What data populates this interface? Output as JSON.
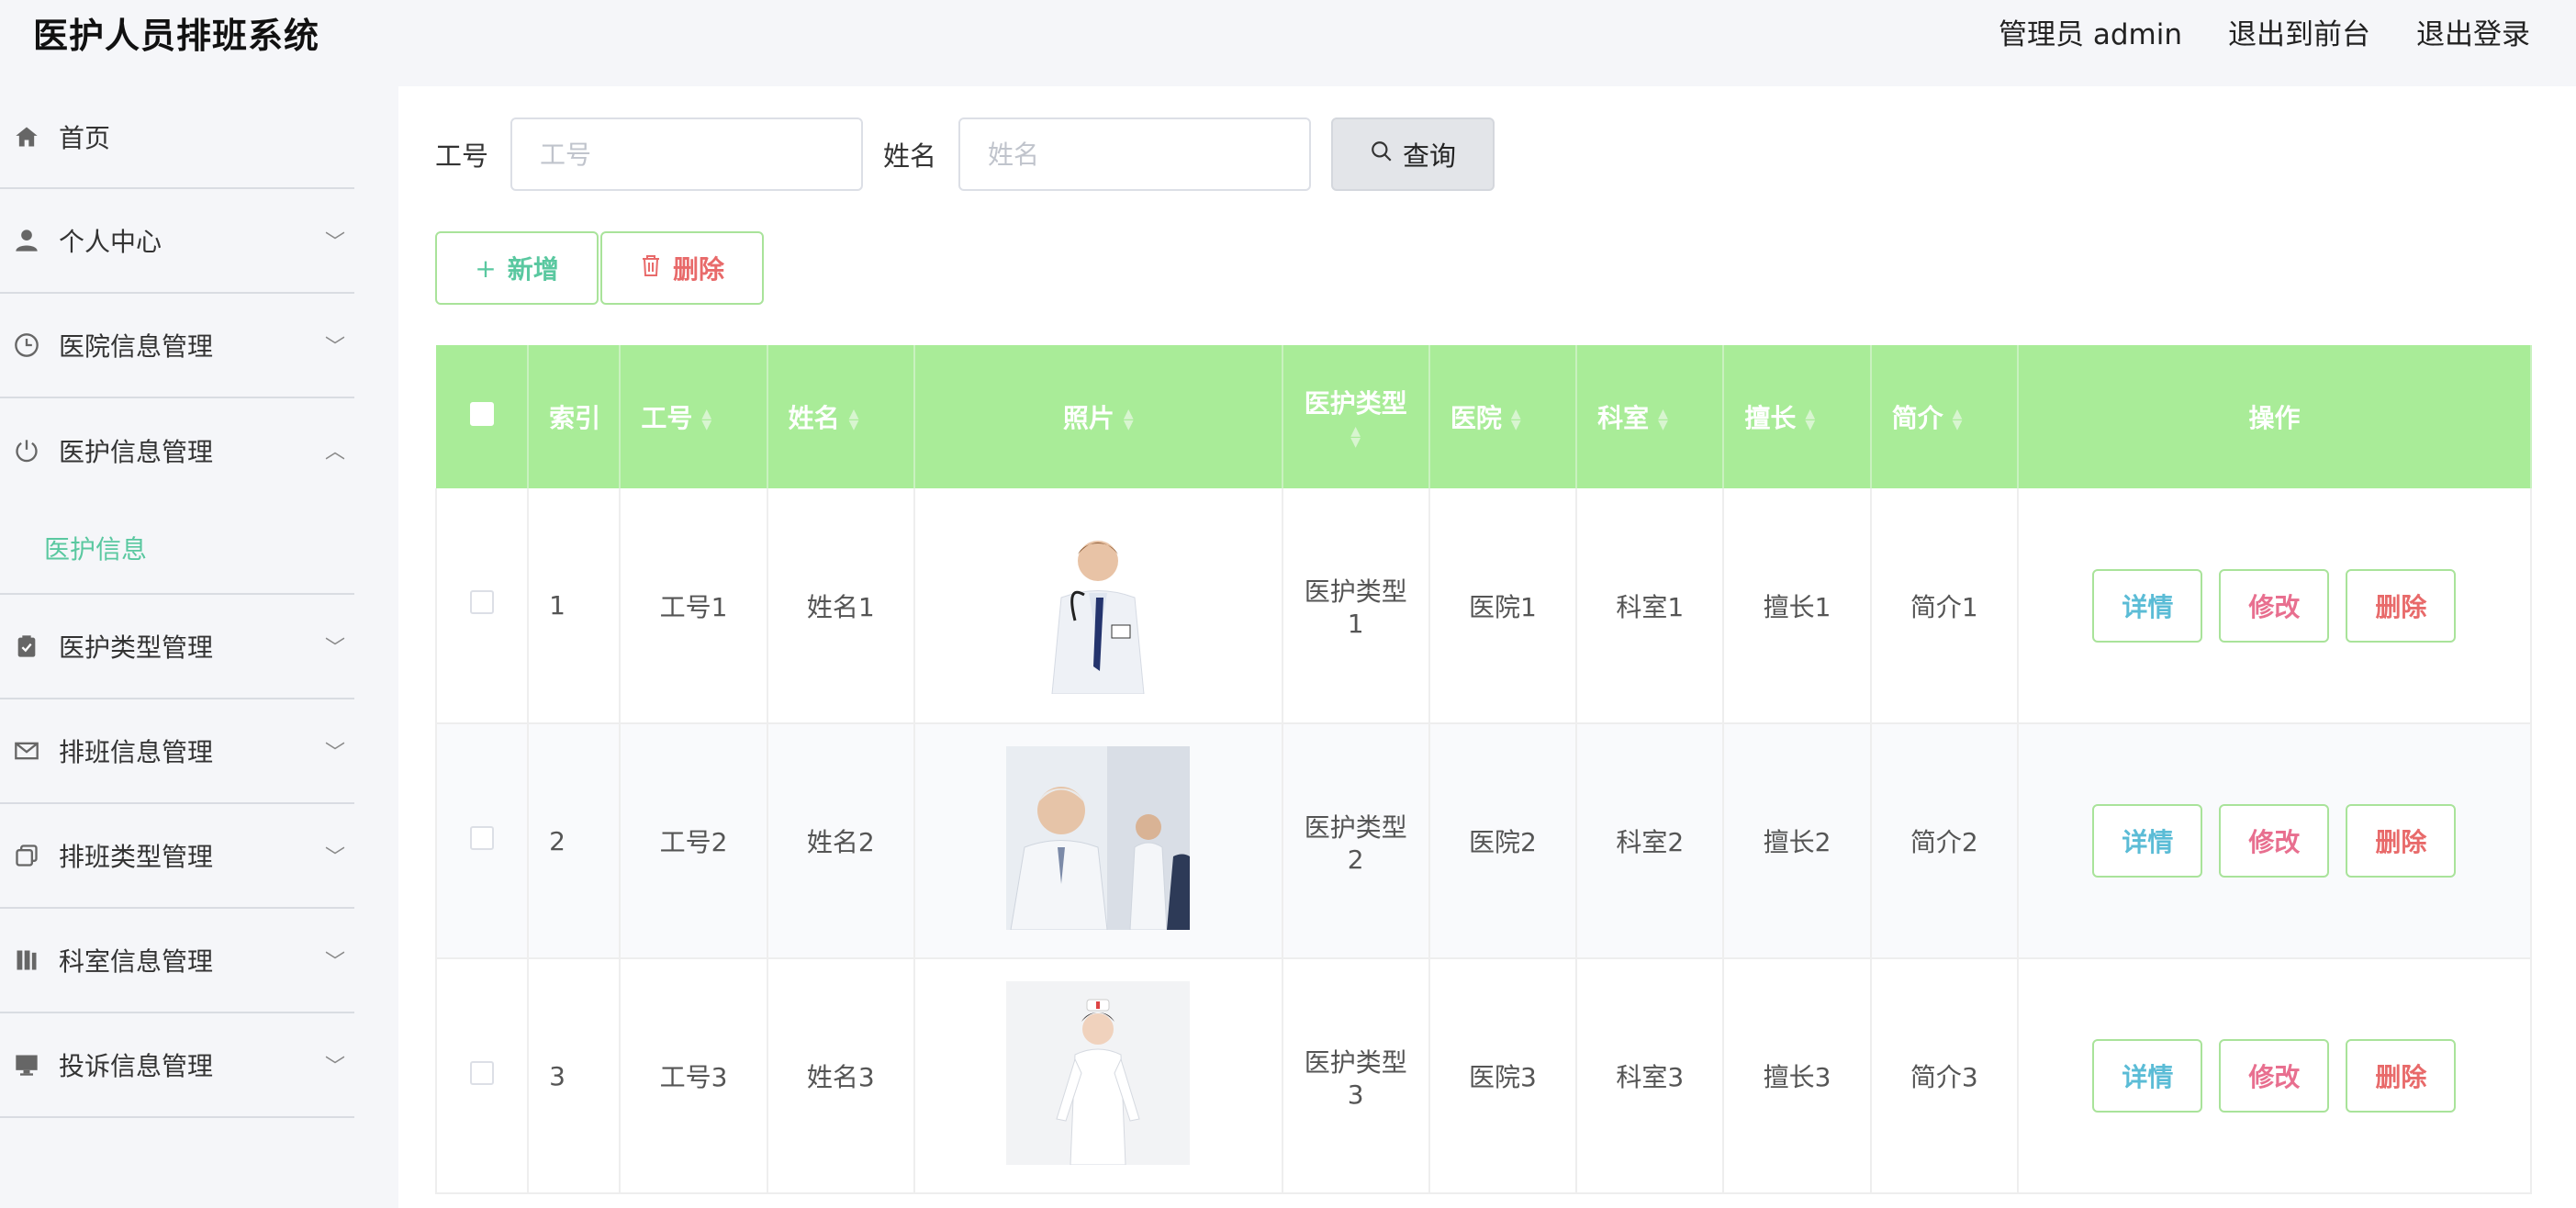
{
  "header": {
    "title": "医护人员排班系统",
    "user": "管理员 admin",
    "to_front": "退出到前台",
    "logout": "退出登录"
  },
  "sidebar": {
    "items": [
      {
        "label": "首页",
        "icon": "home-icon"
      },
      {
        "label": "个人中心",
        "icon": "user-icon"
      },
      {
        "label": "医院信息管理",
        "icon": "clock-icon"
      },
      {
        "label": "医护信息管理",
        "icon": "power-icon",
        "expanded": true,
        "sub": "医护信息"
      },
      {
        "label": "医护类型管理",
        "icon": "clipboard-icon"
      },
      {
        "label": "排班信息管理",
        "icon": "mail-icon"
      },
      {
        "label": "排班类型管理",
        "icon": "copy-icon"
      },
      {
        "label": "科室信息管理",
        "icon": "book-icon"
      },
      {
        "label": "投诉信息管理",
        "icon": "monitor-icon"
      }
    ]
  },
  "search": {
    "id_label": "工号",
    "id_placeholder": "工号",
    "id_value": "",
    "name_label": "姓名",
    "name_placeholder": "姓名",
    "name_value": "",
    "query_label": "查询"
  },
  "actions": {
    "add_label": "新增",
    "delete_label": "删除"
  },
  "table": {
    "columns": [
      "索引",
      "工号",
      "姓名",
      "照片",
      "医护类型",
      "医院",
      "科室",
      "擅长",
      "简介",
      "操作"
    ],
    "rows": [
      {
        "index": "1",
        "id": "工号1",
        "name": "姓名1",
        "type_l1": "医护类型",
        "type_l2": "1",
        "hospital": "医院1",
        "dept": "科室1",
        "skill": "擅长1",
        "intro": "简介1"
      },
      {
        "index": "2",
        "id": "工号2",
        "name": "姓名2",
        "type_l1": "医护类型",
        "type_l2": "2",
        "hospital": "医院2",
        "dept": "科室2",
        "skill": "擅长2",
        "intro": "简介2"
      },
      {
        "index": "3",
        "id": "工号3",
        "name": "姓名3",
        "type_l1": "医护类型",
        "type_l2": "3",
        "hospital": "医院3",
        "dept": "科室3",
        "skill": "擅长3",
        "intro": "简介3"
      }
    ],
    "ops": {
      "detail": "详情",
      "edit": "修改",
      "remove": "删除"
    }
  },
  "colors": {
    "accent": "#5ac8a0",
    "header_bg": "#a9ec98",
    "danger": "#e86a6a"
  }
}
